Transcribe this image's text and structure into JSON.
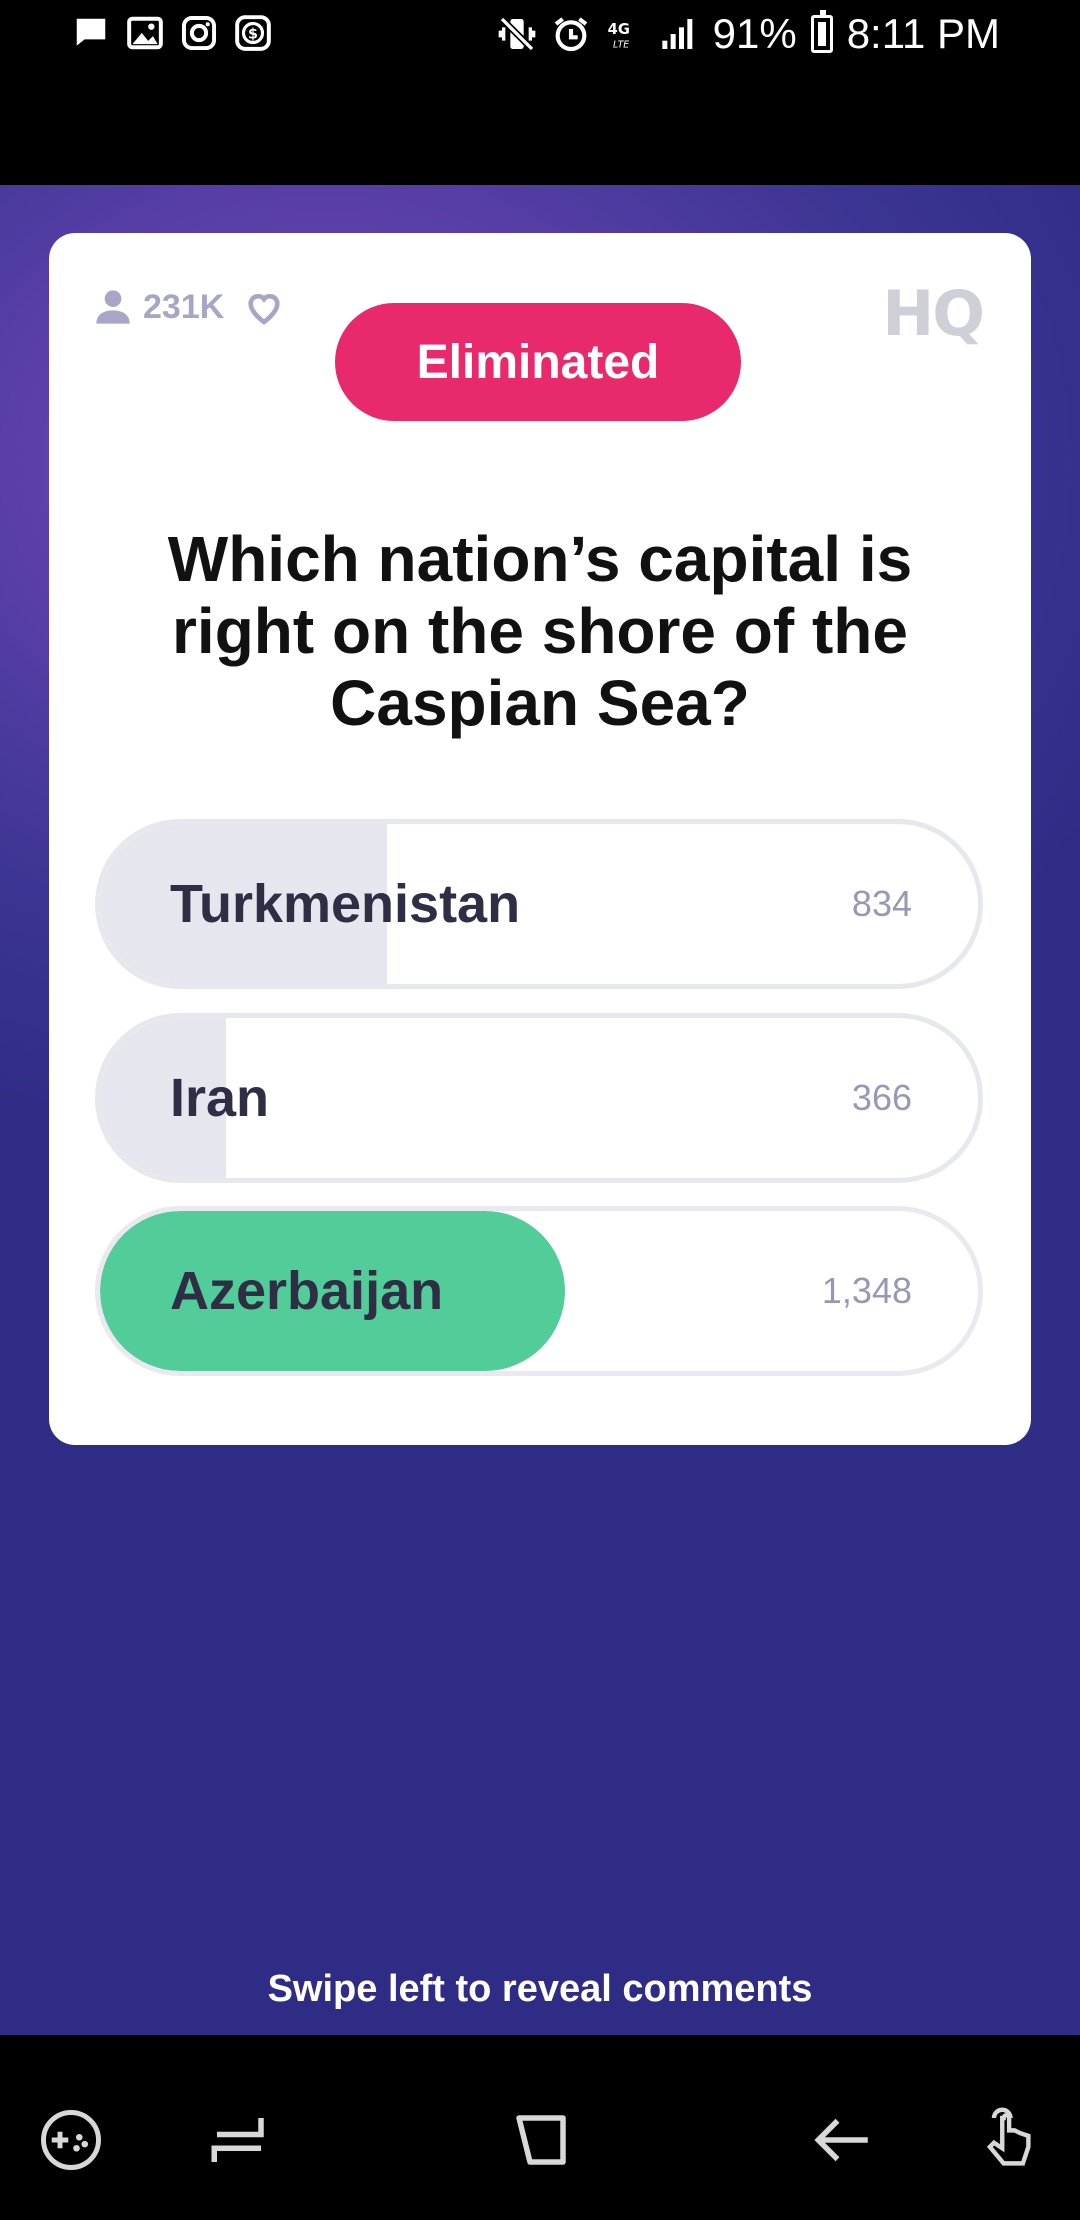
{
  "status_bar": {
    "battery": "91%",
    "time": "8:11 PM",
    "network": "4G LTE",
    "left_icons": [
      "message-icon",
      "image-icon",
      "instagram-icon",
      "cashapp-icon"
    ],
    "right_icons": [
      "vibrate-icon",
      "alarm-icon",
      "lte-icon",
      "signal-icon",
      "battery-icon"
    ]
  },
  "card": {
    "viewers": "231K",
    "logo": "HQ",
    "badge": "Eliminated",
    "question": "Which nation’s capital is right on the shore of the Caspian Sea?",
    "answers": [
      {
        "label": "Turkmenistan",
        "count": "834",
        "fraction": 0.327,
        "correct": false
      },
      {
        "label": "Iran",
        "count": "366",
        "fraction": 0.143,
        "correct": false
      },
      {
        "label": "Azerbaijan",
        "count": "1,348",
        "fraction": 0.53,
        "correct": true
      }
    ],
    "colors": {
      "badge": "#e82a6c",
      "correct": "#52cc98"
    }
  },
  "footer": {
    "swipe_hint": "Swipe left to reveal comments"
  },
  "nav_bar": {
    "icons": [
      "game-launcher-icon",
      "recents-icon",
      "home-icon",
      "back-icon",
      "assistant-gesture-icon"
    ]
  }
}
